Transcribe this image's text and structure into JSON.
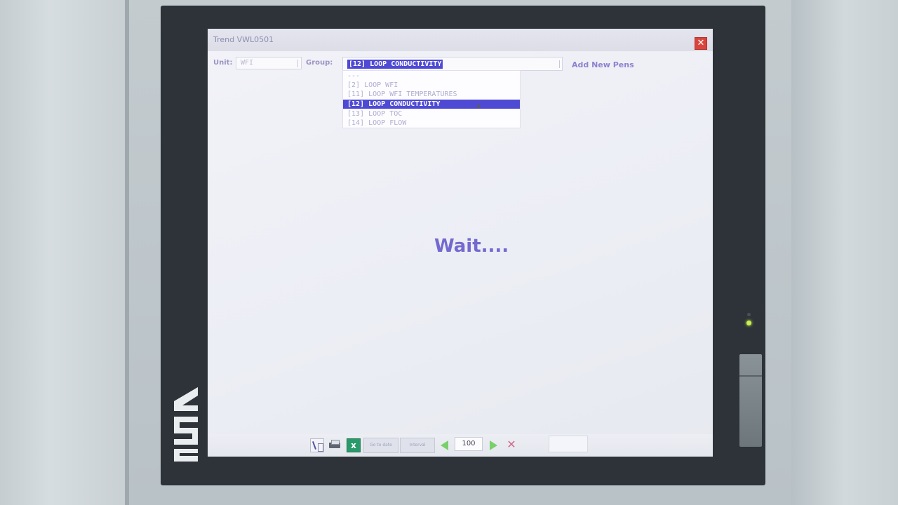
{
  "window": {
    "title": "Trend VWL0501",
    "close_glyph": "✕"
  },
  "filter": {
    "unit_label": "Unit:",
    "unit_value": "WFI",
    "group_label": "Group:",
    "group_value": "[12] LOOP CONDUCTIVITY",
    "add_pens_label": "Add New Pens"
  },
  "dropdown": {
    "items": [
      {
        "label": "---",
        "selected": false
      },
      {
        "label": "[2] LOOP WFI",
        "selected": false
      },
      {
        "label": "[11] LOOP WFI TEMPERATURES",
        "selected": false
      },
      {
        "label": "[12] LOOP CONDUCTIVITY",
        "selected": true
      },
      {
        "label": "[13] LOOP TOC",
        "selected": false
      },
      {
        "label": "[14] LOOP FLOW",
        "selected": false
      }
    ]
  },
  "status": {
    "message": "Wait...."
  },
  "toolbar": {
    "goto_label": "Go to date",
    "interval_label": "Interval",
    "zoom_value": "100",
    "icons": [
      "pen-settings-icon",
      "print-icon",
      "excel-export-icon",
      "arrow-left-icon",
      "arrow-right-icon",
      "cancel-icon"
    ]
  },
  "colors": {
    "selection": "#4e4ad3",
    "wait_text": "#7469cf",
    "close_button": "#d9453c",
    "nav_arrows": "#79d06a"
  }
}
